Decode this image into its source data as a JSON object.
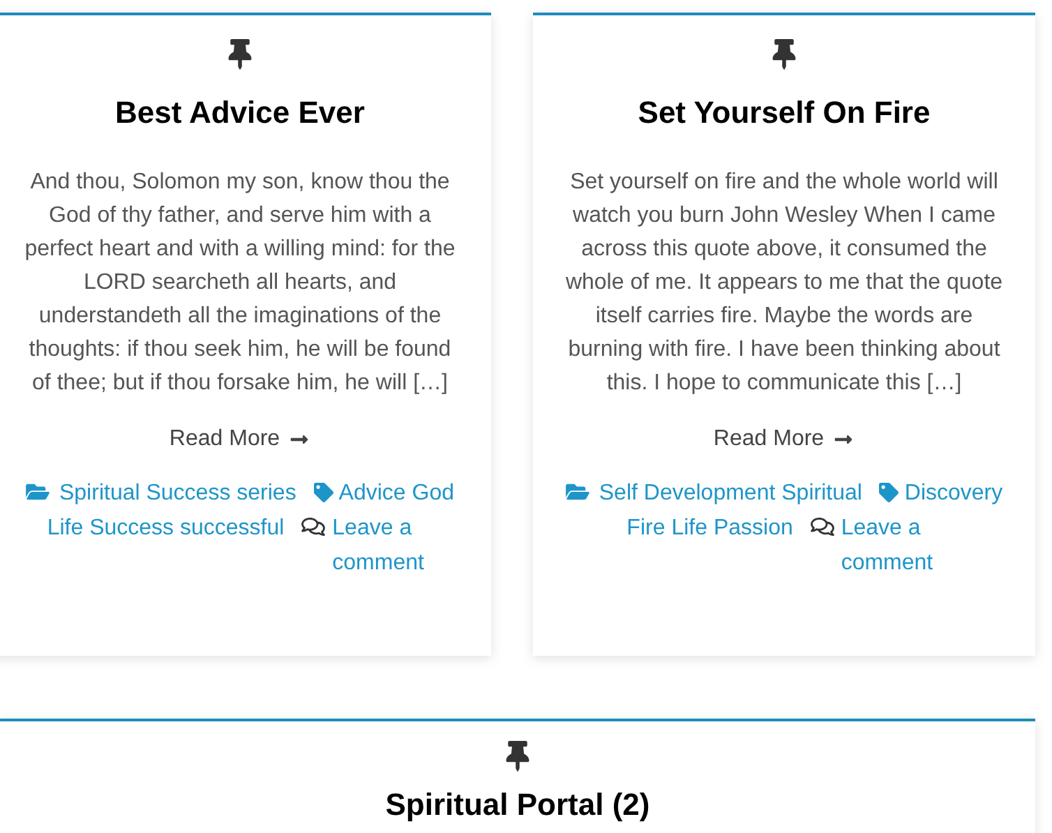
{
  "posts": [
    {
      "title": "Best Advice Ever",
      "excerpt": "And thou, Solomon my son, know thou the God of thy father, and serve him with a perfect heart and with a willing mind: for the LORD searcheth all hearts, and understandeth all the imaginations of the thoughts: if thou seek him, he will be found of thee; but if thou forsake him, he will […]",
      "read_more": "Read More",
      "categories": [
        "Spiritual Success series"
      ],
      "tags": [
        "Advice",
        "God",
        "Life",
        "Success",
        "successful"
      ],
      "comment_link": "Leave a comment"
    },
    {
      "title": "Set Yourself On Fire",
      "excerpt": "Set yourself on fire and the whole world will watch you burn John Wesley When I came across this quote above, it consumed the whole of me. It appears to me that the quote itself carries fire. Maybe the words are burning with fire. I have been thinking about this. I hope to communicate this […]",
      "read_more": "Read More",
      "categories": [
        "Self Development",
        "Spiritual"
      ],
      "tags": [
        "Discovery",
        "Fire",
        "Life",
        "Passion"
      ],
      "comment_link": "Leave a comment"
    }
  ],
  "next_post": {
    "title": "Spiritual Portal (2)"
  }
}
